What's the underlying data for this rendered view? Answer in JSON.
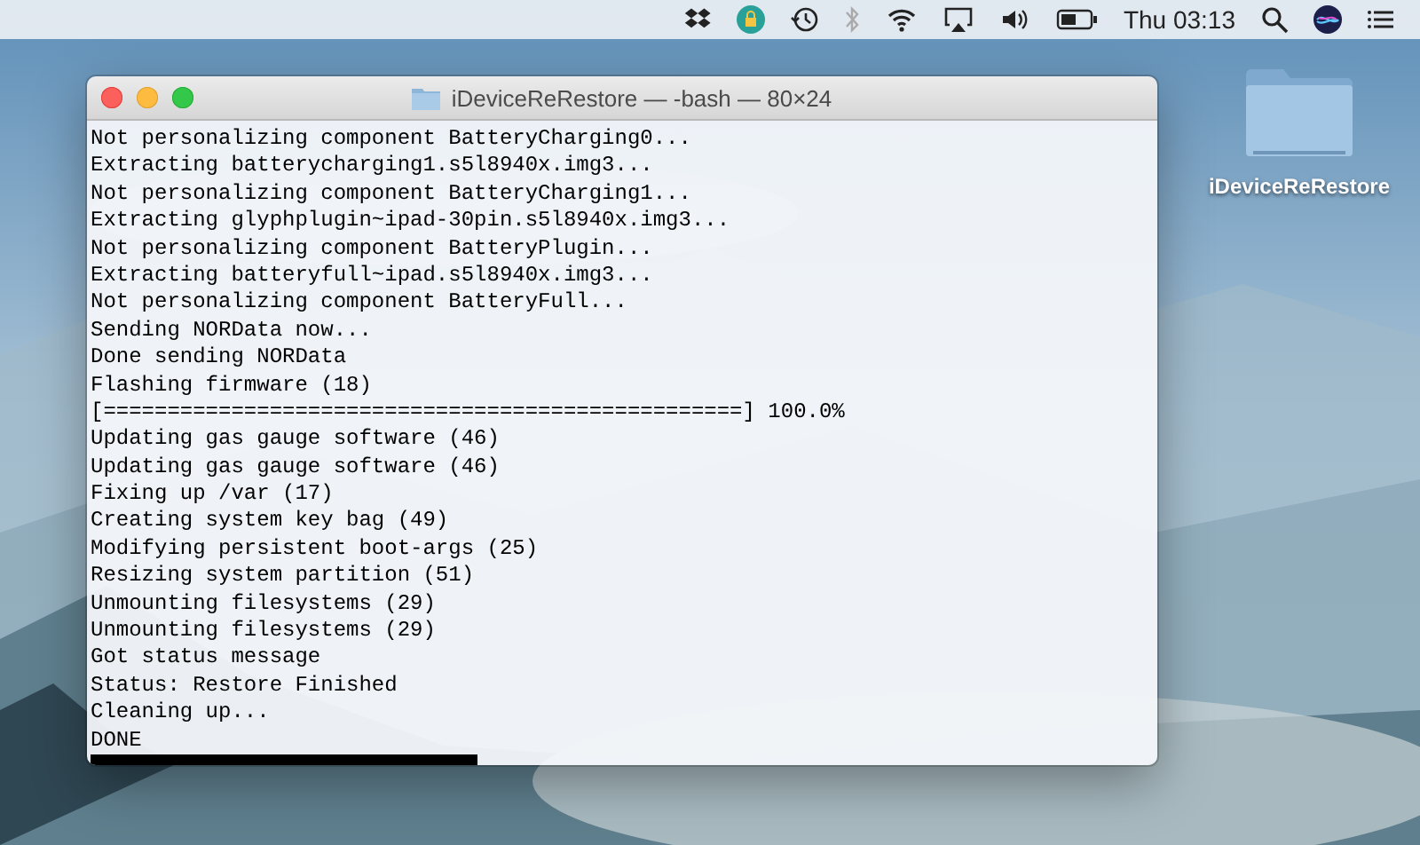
{
  "menubar": {
    "clock": "Thu 03:13"
  },
  "window": {
    "title": "iDeviceReRestore — -bash — 80×24",
    "lines": [
      "Not personalizing component BatteryCharging0...",
      "Extracting batterycharging1.s5l8940x.img3...",
      "Not personalizing component BatteryCharging1...",
      "Extracting glyphplugin~ipad-30pin.s5l8940x.img3...",
      "Not personalizing component BatteryPlugin...",
      "Extracting batteryfull~ipad.s5l8940x.img3...",
      "Not personalizing component BatteryFull...",
      "Sending NORData now...",
      "Done sending NORData",
      "Flashing firmware (18)",
      "[==================================================] 100.0%",
      "Updating gas gauge software (46)",
      "Updating gas gauge software (46)",
      "Fixing up /var (17)",
      "Creating system key bag (49)",
      "Modifying persistent boot-args (25)",
      "Resizing system partition (51)",
      "Unmounting filesystems (29)",
      "Unmounting filesystems (29)",
      "Got status message",
      "Status: Restore Finished",
      "Cleaning up...",
      "DONE"
    ]
  },
  "desktop_icons": [
    {
      "label": "iDeviceReRestore"
    }
  ]
}
